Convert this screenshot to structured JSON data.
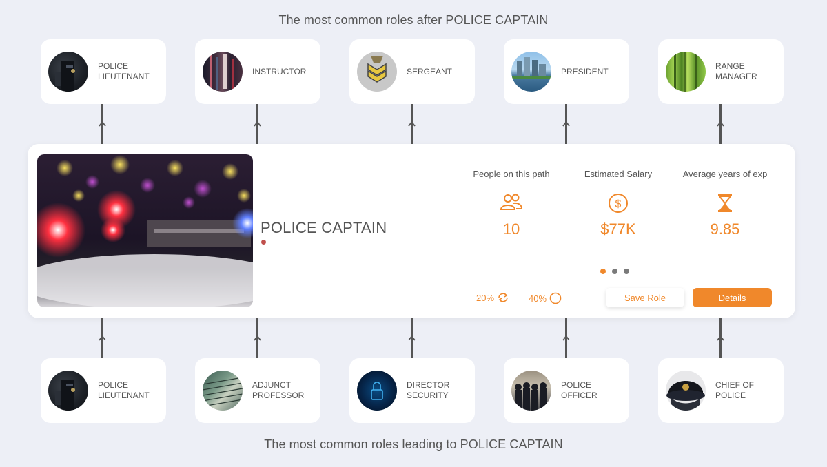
{
  "headings": {
    "top": "The most common roles after POLICE CAPTAIN",
    "bottom": "The most common roles leading to POLICE CAPTAIN"
  },
  "next_roles": [
    {
      "label": "POLICE LIEUTENANT"
    },
    {
      "label": "INSTRUCTOR"
    },
    {
      "label": "SERGEANT"
    },
    {
      "label": "PRESIDENT"
    },
    {
      "label": "RANGE MANAGER"
    }
  ],
  "prev_roles": [
    {
      "label": "POLICE LIEUTENANT"
    },
    {
      "label": "ADJUNCT PROFESSOR"
    },
    {
      "label": "DIRECTOR SECURITY"
    },
    {
      "label": "POLICE OFFICER"
    },
    {
      "label": "CHIEF OF POLICE"
    }
  ],
  "current_role": {
    "title": "POLICE CAPTAIN",
    "stats": [
      {
        "label": "People on this path",
        "value": "10",
        "icon": "people-icon"
      },
      {
        "label": "Estimated Salary",
        "value": "$77K",
        "icon": "dollar-icon"
      },
      {
        "label": "Average years of exp",
        "value": "9.85",
        "icon": "hourglass-icon"
      }
    ],
    "carousel": {
      "total": 3,
      "active_index": 0
    },
    "metrics": [
      {
        "value": "20%",
        "icon": "refresh-icon"
      },
      {
        "value": "40%",
        "icon": "circle-icon"
      }
    ],
    "buttons": {
      "save": "Save Role",
      "details": "Details"
    }
  },
  "colors": {
    "accent": "#f0882b",
    "background": "#edeff6",
    "card": "#ffffff",
    "text": "#555555",
    "marker": "#c0504d"
  }
}
